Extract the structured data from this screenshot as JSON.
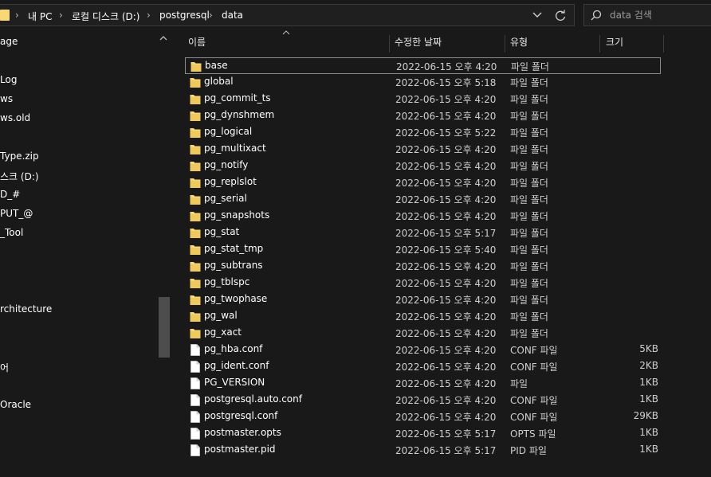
{
  "address_bar": {
    "crumbs": [
      "내 PC",
      "로컬 디스크 (D:)",
      "postgresql",
      "data"
    ],
    "separator": "›"
  },
  "search": {
    "placeholder": "data 검색"
  },
  "sidebar": {
    "items": [
      "age",
      "Log",
      "ws",
      "ws.old",
      "Type.zip",
      "스크 (D:)",
      "D_#",
      "PUT_@",
      "_Tool",
      "rchitecture",
      "어",
      "Oracle"
    ]
  },
  "columns": {
    "name": "이름",
    "date": "수정한 날짜",
    "type": "유형",
    "size": "크기"
  },
  "files": [
    {
      "name": "base",
      "date": "2022-06-15 오후 4:20",
      "type": "파일 폴더",
      "size": "",
      "kind": "folder"
    },
    {
      "name": "global",
      "date": "2022-06-15 오후 5:18",
      "type": "파일 폴더",
      "size": "",
      "kind": "folder"
    },
    {
      "name": "pg_commit_ts",
      "date": "2022-06-15 오후 4:20",
      "type": "파일 폴더",
      "size": "",
      "kind": "folder"
    },
    {
      "name": "pg_dynshmem",
      "date": "2022-06-15 오후 4:20",
      "type": "파일 폴더",
      "size": "",
      "kind": "folder"
    },
    {
      "name": "pg_logical",
      "date": "2022-06-15 오후 5:22",
      "type": "파일 폴더",
      "size": "",
      "kind": "folder"
    },
    {
      "name": "pg_multixact",
      "date": "2022-06-15 오후 4:20",
      "type": "파일 폴더",
      "size": "",
      "kind": "folder"
    },
    {
      "name": "pg_notify",
      "date": "2022-06-15 오후 4:20",
      "type": "파일 폴더",
      "size": "",
      "kind": "folder"
    },
    {
      "name": "pg_replslot",
      "date": "2022-06-15 오후 4:20",
      "type": "파일 폴더",
      "size": "",
      "kind": "folder"
    },
    {
      "name": "pg_serial",
      "date": "2022-06-15 오후 4:20",
      "type": "파일 폴더",
      "size": "",
      "kind": "folder"
    },
    {
      "name": "pg_snapshots",
      "date": "2022-06-15 오후 4:20",
      "type": "파일 폴더",
      "size": "",
      "kind": "folder"
    },
    {
      "name": "pg_stat",
      "date": "2022-06-15 오후 5:17",
      "type": "파일 폴더",
      "size": "",
      "kind": "folder"
    },
    {
      "name": "pg_stat_tmp",
      "date": "2022-06-15 오후 5:40",
      "type": "파일 폴더",
      "size": "",
      "kind": "folder"
    },
    {
      "name": "pg_subtrans",
      "date": "2022-06-15 오후 4:20",
      "type": "파일 폴더",
      "size": "",
      "kind": "folder"
    },
    {
      "name": "pg_tblspc",
      "date": "2022-06-15 오후 4:20",
      "type": "파일 폴더",
      "size": "",
      "kind": "folder"
    },
    {
      "name": "pg_twophase",
      "date": "2022-06-15 오후 4:20",
      "type": "파일 폴더",
      "size": "",
      "kind": "folder"
    },
    {
      "name": "pg_wal",
      "date": "2022-06-15 오후 4:20",
      "type": "파일 폴더",
      "size": "",
      "kind": "folder"
    },
    {
      "name": "pg_xact",
      "date": "2022-06-15 오후 4:20",
      "type": "파일 폴더",
      "size": "",
      "kind": "folder"
    },
    {
      "name": "pg_hba.conf",
      "date": "2022-06-15 오후 4:20",
      "type": "CONF 파일",
      "size": "5KB",
      "kind": "file"
    },
    {
      "name": "pg_ident.conf",
      "date": "2022-06-15 오후 4:20",
      "type": "CONF 파일",
      "size": "2KB",
      "kind": "file"
    },
    {
      "name": "PG_VERSION",
      "date": "2022-06-15 오후 4:20",
      "type": "파일",
      "size": "1KB",
      "kind": "file"
    },
    {
      "name": "postgresql.auto.conf",
      "date": "2022-06-15 오후 4:20",
      "type": "CONF 파일",
      "size": "1KB",
      "kind": "file"
    },
    {
      "name": "postgresql.conf",
      "date": "2022-06-15 오후 4:20",
      "type": "CONF 파일",
      "size": "29KB",
      "kind": "file"
    },
    {
      "name": "postmaster.opts",
      "date": "2022-06-15 오후 5:17",
      "type": "OPTS 파일",
      "size": "1KB",
      "kind": "file"
    },
    {
      "name": "postmaster.pid",
      "date": "2022-06-15 오후 5:17",
      "type": "PID 파일",
      "size": "1KB",
      "kind": "file"
    }
  ],
  "selected_file": "base",
  "colors": {
    "background": "#191919",
    "folder": "#f8d775",
    "file": "#ffffff",
    "text": "#ffffff",
    "muted": "#cfcfcf"
  },
  "icons": {
    "folder": "folder-icon",
    "file": "file-icon",
    "refresh": "refresh-icon",
    "search": "search-icon",
    "dropdown": "chevron-down-icon",
    "scroll_up": "chevron-up-icon",
    "sort": "sort-ascending-icon"
  }
}
